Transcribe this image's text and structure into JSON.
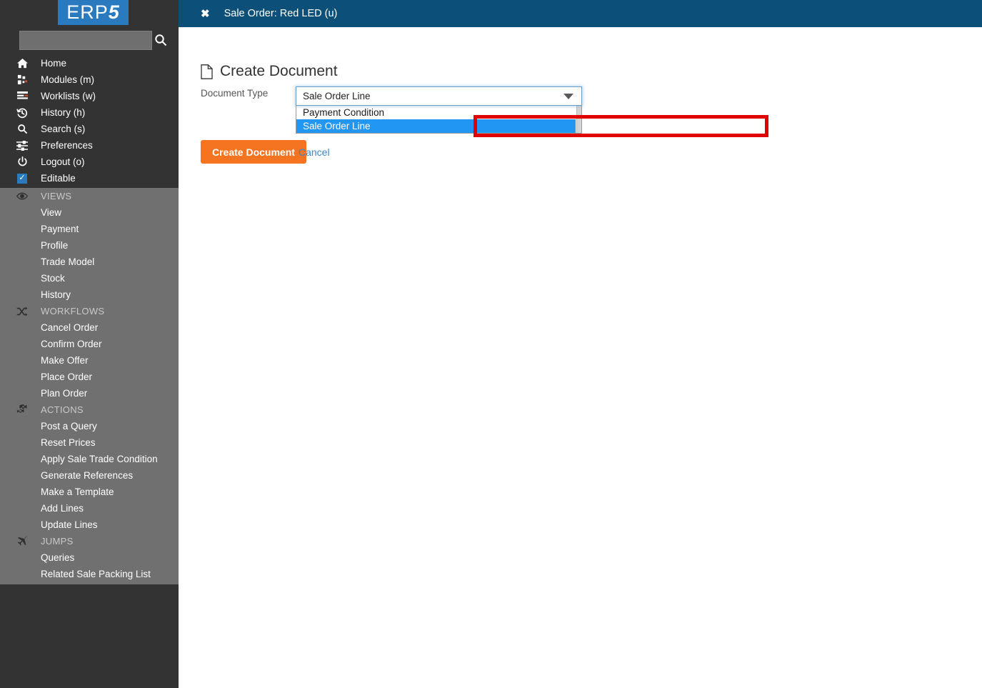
{
  "brand": {
    "logo_text": "ERP",
    "logo_accent": "5",
    "logo_bg": "#2a7ac0"
  },
  "sidebar": {
    "search": {
      "value": "",
      "placeholder": "",
      "icon": "search-icon"
    },
    "nav": [
      {
        "label": "Home",
        "icon": "home-icon"
      },
      {
        "label": "Modules (m)",
        "icon": "modules-icon"
      },
      {
        "label": "Worklists (w)",
        "icon": "worklists-icon"
      },
      {
        "label": "History (h)",
        "icon": "history-icon"
      },
      {
        "label": "Search (s)",
        "icon": "search-icon"
      },
      {
        "label": "Preferences",
        "icon": "sliders-icon"
      },
      {
        "label": "Logout (o)",
        "icon": "power-icon"
      },
      {
        "label": "Editable",
        "icon": "checkbox-checked-icon"
      }
    ],
    "sections": [
      {
        "title": "VIEWS",
        "icon": "eye-icon",
        "items": [
          "View",
          "Payment",
          "Profile",
          "Trade Model",
          "Stock",
          "History"
        ]
      },
      {
        "title": "WORKFLOWS",
        "icon": "shuffle-icon",
        "items": [
          "Cancel Order",
          "Confirm Order",
          "Make Offer",
          "Place Order",
          "Plan Order"
        ]
      },
      {
        "title": "ACTIONS",
        "icon": "gears-icon",
        "items": [
          "Post a Query",
          "Reset Prices",
          "Apply Sale Trade Condition",
          "Generate References",
          "Make a Template",
          "Add Lines",
          "Update Lines"
        ]
      },
      {
        "title": "JUMPS",
        "icon": "airplane-icon",
        "items": [
          "Queries",
          "Related Sale Packing List"
        ]
      }
    ]
  },
  "topbar": {
    "close_icon": "close-icon",
    "close_glyph": "✖",
    "title": "Sale Order: Red LED (u)",
    "bg": "#0c4f78"
  },
  "main": {
    "page_title": "Create Document",
    "page_title_icon": "document-icon",
    "field_label": "Document Type",
    "select": {
      "name": "document-type-select",
      "value": "Sale Order Line",
      "expanded": true,
      "caret_icon": "chevron-down-icon",
      "options": [
        "Payment Condition",
        "Sale Order Line"
      ],
      "selected_index": 1,
      "highlight_color": "#2196f3"
    },
    "annotation": {
      "type": "red-rectangle",
      "color": "#e00000"
    },
    "create_button": {
      "label": "Create Document",
      "color": "#f47421"
    },
    "cancel_link": {
      "label": "Cancel",
      "color": "#3c87c7"
    }
  }
}
